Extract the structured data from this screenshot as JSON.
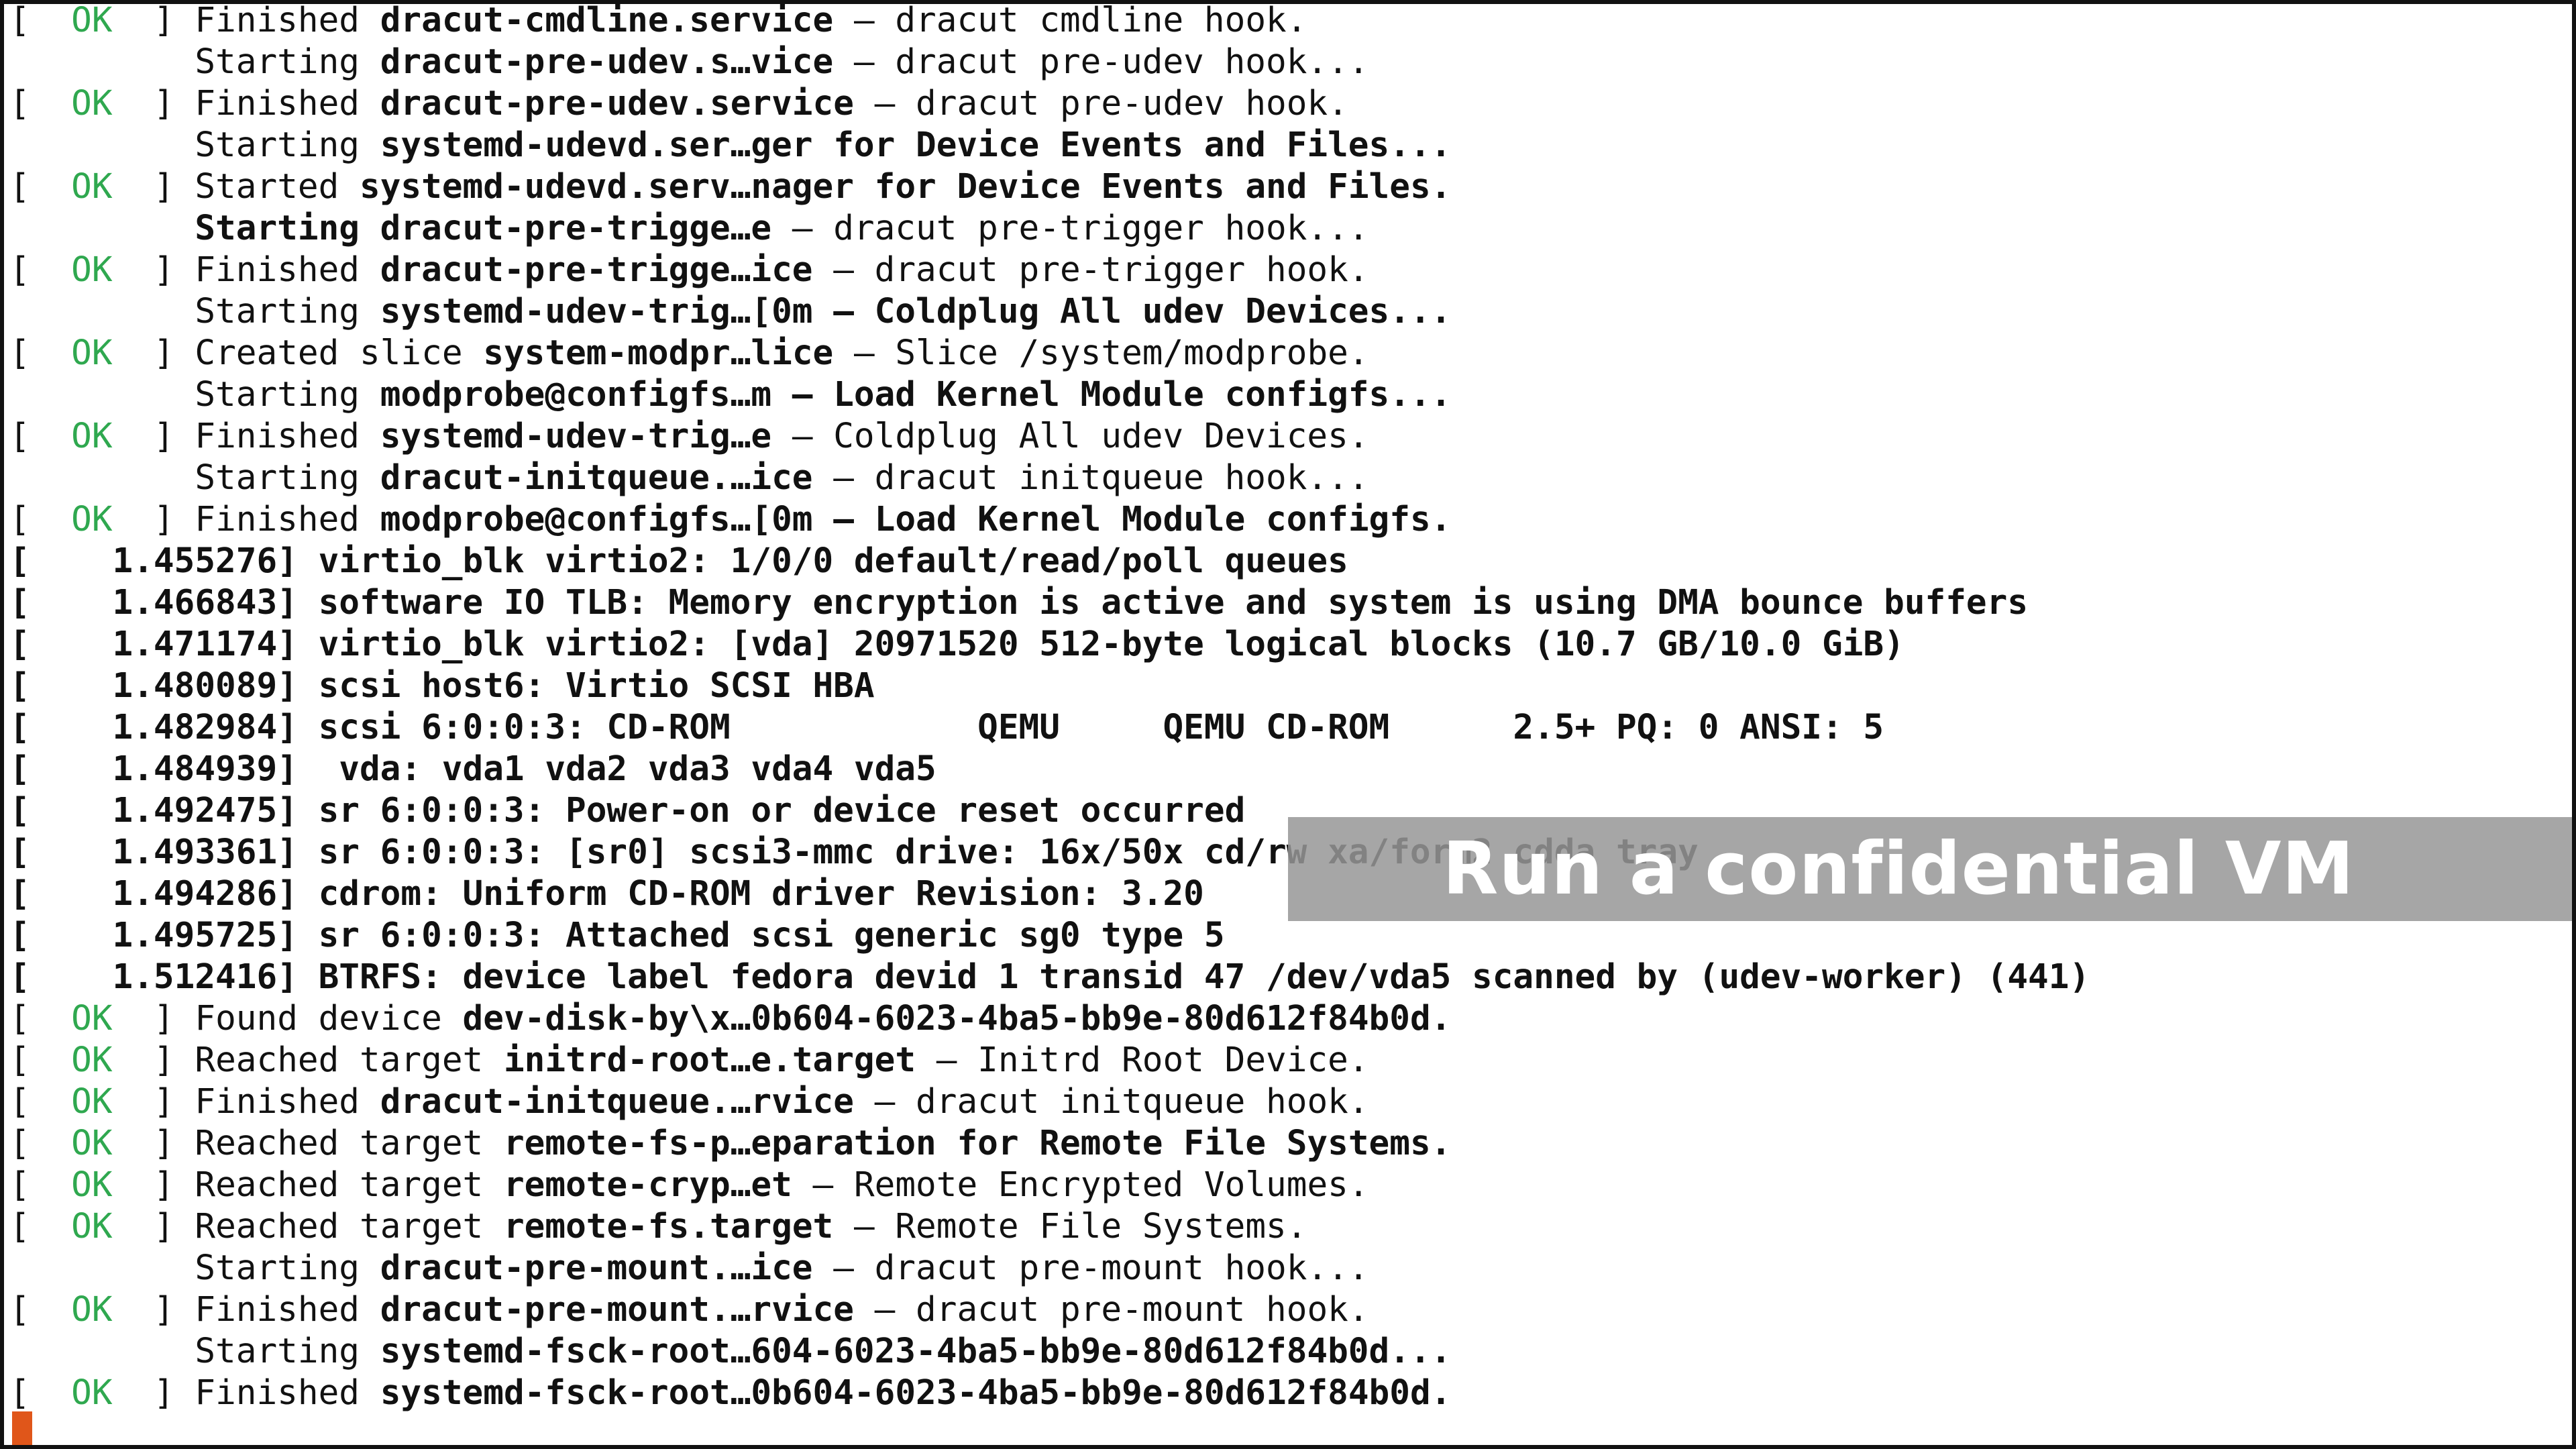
{
  "overlay": {
    "title": "Run a confidential VM"
  },
  "colors": {
    "ok": "#2fa84f",
    "cursor": "#e0561a",
    "banner": "#969696"
  },
  "lines": [
    {
      "status": "ok",
      "text": "Finished ",
      "bold": "dracut-cmdline.service",
      "rest": " – dracut cmdline hook."
    },
    {
      "status": "none",
      "text": "Starting ",
      "bold": "dracut-pre-udev.s…vice",
      "rest": " – dracut pre-udev hook..."
    },
    {
      "status": "ok",
      "text": "Finished ",
      "bold": "dracut-pre-udev.service",
      "rest": " – dracut pre-udev hook."
    },
    {
      "status": "none",
      "text": "Starting ",
      "bold": "systemd-udevd.ser…ger for Device Events and Files...",
      "rest": ""
    },
    {
      "status": "ok",
      "text": "Started ",
      "bold": "systemd-udevd.serv…nager for Device Events and Files.",
      "rest": ""
    },
    {
      "status": "none",
      "text": "",
      "bold": "Starting dracut-pre-trigge…e",
      "rest": " – dracut pre-trigger hook..."
    },
    {
      "status": "ok",
      "text": "Finished ",
      "bold": "dracut-pre-trigge…ice",
      "rest": " – dracut pre-trigger hook."
    },
    {
      "status": "none",
      "text": "Starting ",
      "bold": "systemd-udev-trig…[0m – Coldplug All udev Devices...",
      "rest": ""
    },
    {
      "status": "ok",
      "text": "Created slice ",
      "bold": "system-modpr…lice",
      "rest": " – Slice /system/modprobe."
    },
    {
      "status": "none",
      "text": "Starting ",
      "bold": "modprobe@configfs…m – Load Kernel Module configfs...",
      "rest": ""
    },
    {
      "status": "ok",
      "text": "Finished ",
      "bold": "systemd-udev-trig…e",
      "rest": " – Coldplug All udev Devices."
    },
    {
      "status": "none",
      "text": "Starting ",
      "bold": "dracut-initqueue.…ice",
      "rest": " – dracut initqueue hook..."
    },
    {
      "status": "ok",
      "text": "Finished ",
      "bold": "modprobe@configfs…[0m – Load Kernel Module configfs.",
      "rest": ""
    },
    {
      "status": "kernel",
      "text": "[    1.455276] virtio_blk virtio2: 1/0/0 default/read/poll queues"
    },
    {
      "status": "kernel",
      "text": "[    1.466843] software IO TLB: Memory encryption is active and system is using DMA bounce buffers"
    },
    {
      "status": "kernel",
      "text": "[    1.471174] virtio_blk virtio2: [vda] 20971520 512-byte logical blocks (10.7 GB/10.0 GiB)"
    },
    {
      "status": "kernel",
      "text": "[    1.480089] scsi host6: Virtio SCSI HBA"
    },
    {
      "status": "kernel",
      "text": "[    1.482984] scsi 6:0:0:3: CD-ROM            QEMU     QEMU CD-ROM      2.5+ PQ: 0 ANSI: 5"
    },
    {
      "status": "kernel",
      "text": "[    1.484939]  vda: vda1 vda2 vda3 vda4 vda5"
    },
    {
      "status": "kernel",
      "text": "[    1.492475] sr 6:0:0:3: Power-on or device reset occurred"
    },
    {
      "status": "kernel",
      "text": "[    1.493361] sr 6:0:0:3: [sr0] scsi3-mmc drive: 16x/50x cd/rw xa/form2 cdda tray"
    },
    {
      "status": "kernel",
      "text": "[    1.494286] cdrom: Uniform CD-ROM driver Revision: 3.20"
    },
    {
      "status": "kernel",
      "text": "[    1.495725] sr 6:0:0:3: Attached scsi generic sg0 type 5"
    },
    {
      "status": "kernel",
      "text": "[    1.512416] BTRFS: device label fedora devid 1 transid 47 /dev/vda5 scanned by (udev-worker) (441)"
    },
    {
      "status": "ok",
      "text": "Found device ",
      "bold": "dev-disk-by\\x…0b604-6023-4ba5-bb9e-80d612f84b0d.",
      "rest": ""
    },
    {
      "status": "ok",
      "text": "Reached target ",
      "bold": "initrd-root…e.target",
      "rest": " – Initrd Root Device."
    },
    {
      "status": "ok",
      "text": "Finished ",
      "bold": "dracut-initqueue.…rvice",
      "rest": " – dracut initqueue hook."
    },
    {
      "status": "ok",
      "text": "Reached target ",
      "bold": "remote-fs-p…eparation for Remote File Systems.",
      "rest": ""
    },
    {
      "status": "ok",
      "text": "Reached target ",
      "bold": "remote-cryp…et",
      "rest": " – Remote Encrypted Volumes."
    },
    {
      "status": "ok",
      "text": "Reached target ",
      "bold": "remote-fs.target",
      "rest": " – Remote File Systems."
    },
    {
      "status": "none",
      "text": "Starting ",
      "bold": "dracut-pre-mount.…ice",
      "rest": " – dracut pre-mount hook..."
    },
    {
      "status": "ok",
      "text": "Finished ",
      "bold": "dracut-pre-mount.…rvice",
      "rest": " – dracut pre-mount hook."
    },
    {
      "status": "none",
      "text": "Starting ",
      "bold": "systemd-fsck-root…604-6023-4ba5-bb9e-80d612f84b0d...",
      "rest": ""
    },
    {
      "status": "ok",
      "text": "Finished ",
      "bold": "systemd-fsck-root…0b604-6023-4ba5-bb9e-80d612f84b0d.",
      "rest": ""
    }
  ]
}
